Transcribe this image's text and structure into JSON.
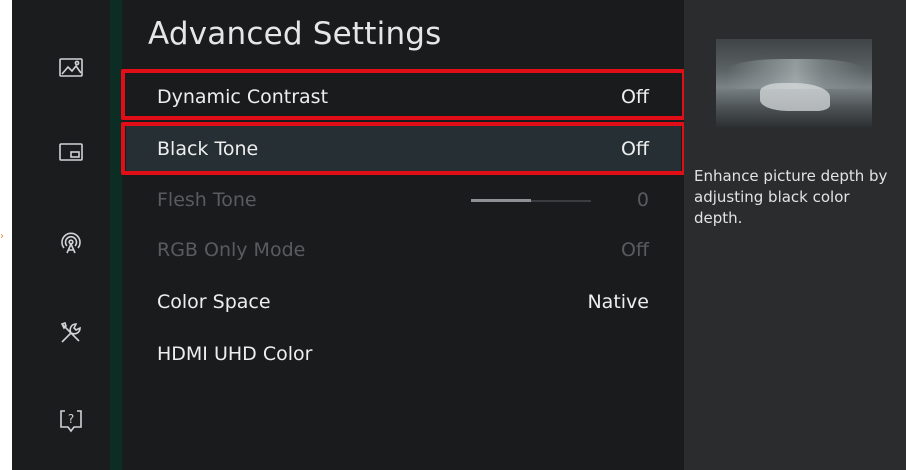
{
  "title": "Advanced Settings",
  "sidebar": {
    "icons": [
      "picture-icon",
      "screen-icon",
      "broadcast-icon",
      "tools-icon",
      "support-icon"
    ]
  },
  "rows": [
    {
      "label": "Dynamic Contrast",
      "value": "Off",
      "state": "enabled",
      "highlighted": true
    },
    {
      "label": "Black Tone",
      "value": "Off",
      "state": "selected",
      "highlighted": true
    },
    {
      "label": "Flesh Tone",
      "value": "0",
      "state": "disabled",
      "slider_level": 0.5
    },
    {
      "label": "RGB Only Mode",
      "value": "Off",
      "state": "disabled"
    },
    {
      "label": "Color Space",
      "value": "Native",
      "state": "enabled"
    },
    {
      "label": "HDMI UHD Color",
      "value": "",
      "state": "enabled"
    }
  ],
  "description": "Enhance picture depth by adjusting black color depth.",
  "colors": {
    "highlight": "#e10e17",
    "accent_bar": "#0b2d24",
    "background": "#191b1d"
  }
}
